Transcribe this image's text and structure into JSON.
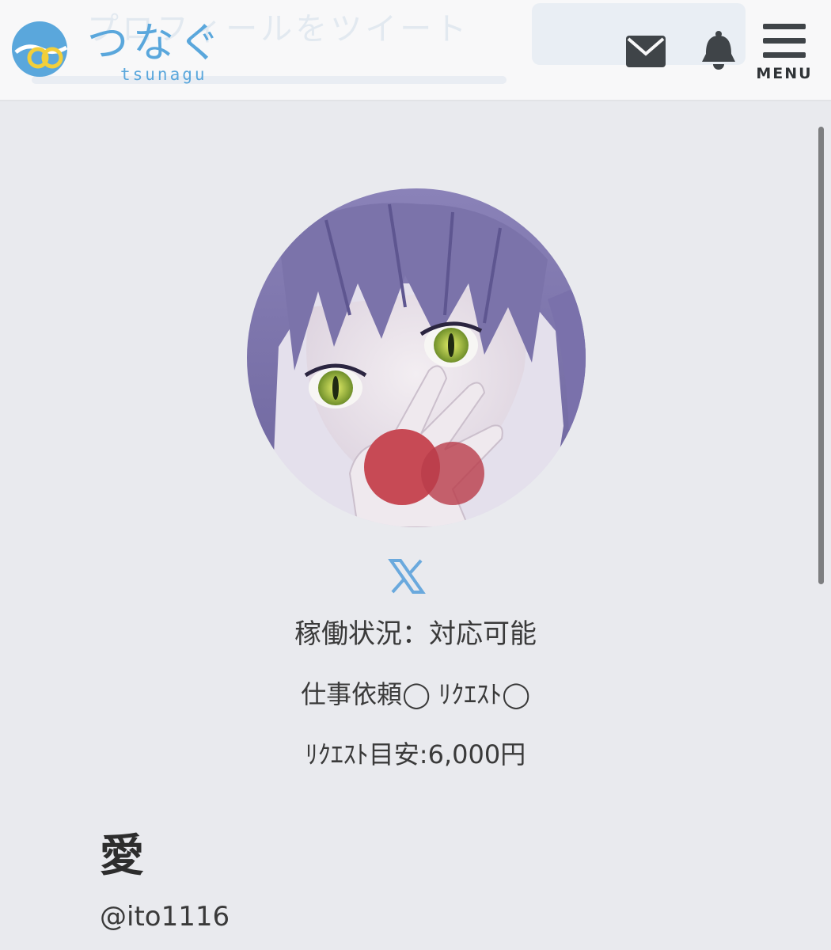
{
  "header": {
    "logo_text": "つなぐ",
    "logo_sub": "tsunagu",
    "background_text": "プロフィールをツイート",
    "icons": {
      "mail": "mail-icon",
      "notifications": "bell-icon",
      "menu": "hamburger-menu-icon"
    },
    "menu_label": "MENU"
  },
  "profile": {
    "avatar": "avatar-image",
    "social_icon": "x-logo-icon",
    "availability": "稼働状況：対応可能",
    "work_request": "仕事依頼◯ ﾘｸｴｽﾄ◯",
    "request_price": "ﾘｸｴｽﾄ目安:6,000円",
    "display_name": "愛",
    "handle": "@ito1116"
  },
  "colors": {
    "page_bg": "#e9eaee",
    "header_bg": "#f8f8f9",
    "brand_blue": "#5aa7dc",
    "brand_yellow": "#f2cf3a",
    "icon_gray": "#3f4448",
    "x_blue": "#6aa9dd"
  }
}
